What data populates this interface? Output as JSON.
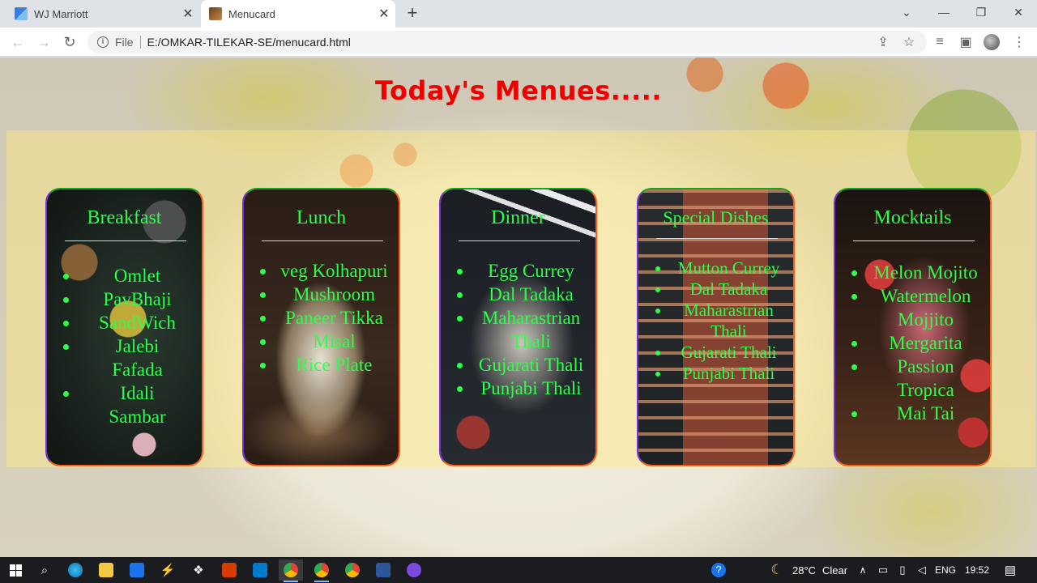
{
  "browser": {
    "tabs": [
      {
        "title": "WJ Marriott",
        "active": false
      },
      {
        "title": "Menucard",
        "active": true
      }
    ],
    "address": {
      "scheme": "File",
      "url": "E:/OMKAR-TILEKAR-SE/menucard.html"
    }
  },
  "page": {
    "heading": "Today's Menues.....",
    "cards": [
      {
        "title": "Breakfast",
        "items": [
          "Omlet",
          "PavBhaji",
          "SandWich",
          "Jalebi",
          "Fafada",
          "Idali",
          "Sambar"
        ]
      },
      {
        "title": "Lunch",
        "items": [
          "veg Kolhapuri",
          "Mushroom",
          "Paneer Tikka",
          "Misal",
          "Rice Plate"
        ]
      },
      {
        "title": "Dinner",
        "items": [
          "Egg Currey",
          "Dal Tadaka",
          "Maharastrian Thali",
          "Gujarati Thali",
          "Punjabi Thali"
        ]
      },
      {
        "title": "Special Dishes",
        "items": [
          "Mutton Currey",
          "Dal Tadaka",
          "Maharastrian Thali",
          "Gujarati Thali",
          "Punjabi Thali"
        ]
      },
      {
        "title": "Mocktails",
        "items": [
          "Melon Mojito",
          "Watermelon Mojjito",
          "Mergarita",
          "Passion Tropica",
          "Mai Tai"
        ]
      }
    ]
  },
  "taskbar": {
    "weather": {
      "temp": "28°C",
      "condition": "Clear"
    },
    "language": "ENG",
    "time": "19:52"
  },
  "colors": {
    "heading": "#ee0000",
    "card_text": "#2bff4a",
    "veil": "#ffec82"
  }
}
